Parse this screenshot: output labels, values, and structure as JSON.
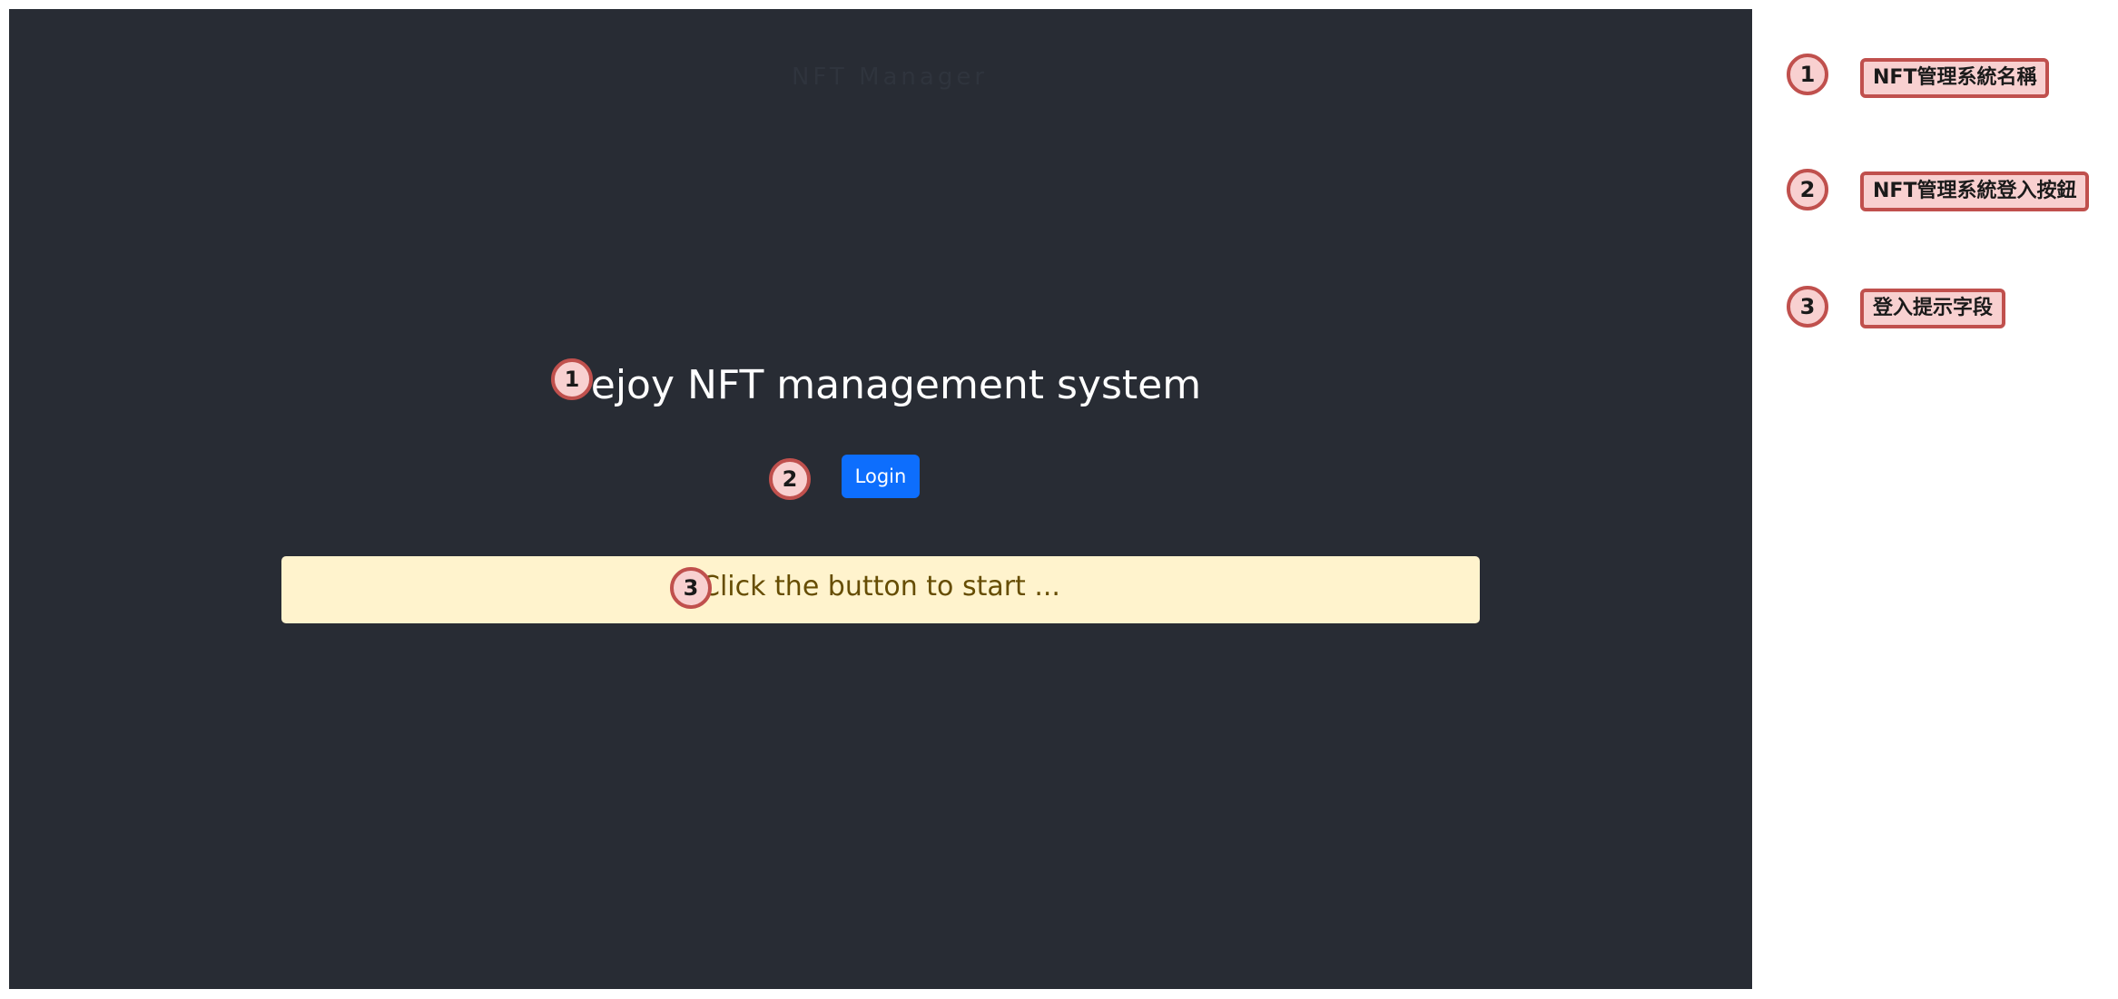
{
  "app": {
    "faint_header": "NFT Manager",
    "title": "Dejoy NFT management system",
    "login_button_label": "Login",
    "hint_text": "Click the button to start ..."
  },
  "annotations": {
    "markers": [
      "1",
      "2",
      "3"
    ],
    "legend": [
      {
        "number": "1",
        "label": "NFT管理系統名稱"
      },
      {
        "number": "2",
        "label": "NFT管理系統登入按鈕"
      },
      {
        "number": "3",
        "label": "登入提示字段"
      }
    ]
  },
  "colors": {
    "window_background": "#282c34",
    "primary_button": "#0d6efd",
    "hint_background": "#fff3cd",
    "hint_text": "#664d03",
    "marker_fill": "#f8d0d0",
    "marker_border": "#c0504d"
  }
}
